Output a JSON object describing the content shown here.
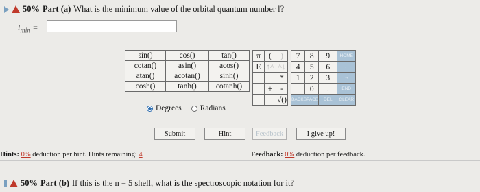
{
  "part_a": {
    "percent": "50%",
    "part_label": "Part (a)",
    "question": "What is the minimum value of the orbital quantum number l?",
    "answer_label": "l",
    "answer_sub": "min",
    "answer_eq": "=",
    "answer_value": ""
  },
  "functions": [
    [
      "sin()",
      "cos()",
      "tan()"
    ],
    [
      "cotan()",
      "asin()",
      "acos()"
    ],
    [
      "atan()",
      "acotan()",
      "sinh()"
    ],
    [
      "cosh()",
      "tanh()",
      "cotanh()"
    ]
  ],
  "angle": {
    "degrees": "Degrees",
    "radians": "Radians",
    "selected": "Degrees"
  },
  "keypad": {
    "row1": [
      "π",
      "(",
      ")",
      "7",
      "8",
      "9",
      "HOME"
    ],
    "row2": [
      "E",
      "↑^",
      "^↓",
      "4",
      "5",
      "6",
      "←"
    ],
    "row3": [
      "",
      "",
      "*",
      "1",
      "2",
      "3",
      "→"
    ],
    "row4": [
      "",
      "+",
      "-",
      "0",
      "",
      ".",
      "END"
    ],
    "row5_a": "√()",
    "row5_b": "BACKSPACE",
    "row5_c": "DEL",
    "row5_d": "CLEAR"
  },
  "buttons": {
    "submit": "Submit",
    "hint": "Hint",
    "feedback": "Feedback",
    "give_up": "I give up!"
  },
  "hints_bar": {
    "label": "Hints:",
    "deduction": "0%",
    "deduction_text": "deduction per hint. Hints remaining:",
    "remaining": "4",
    "feedback_label": "Feedback:",
    "feedback_deduction": "0%",
    "feedback_text": "deduction per feedback."
  },
  "part_b": {
    "percent": "50%",
    "part_label": "Part (b)",
    "question": "If this is the n = 5 shell, what is the spectroscopic notation for it?"
  }
}
